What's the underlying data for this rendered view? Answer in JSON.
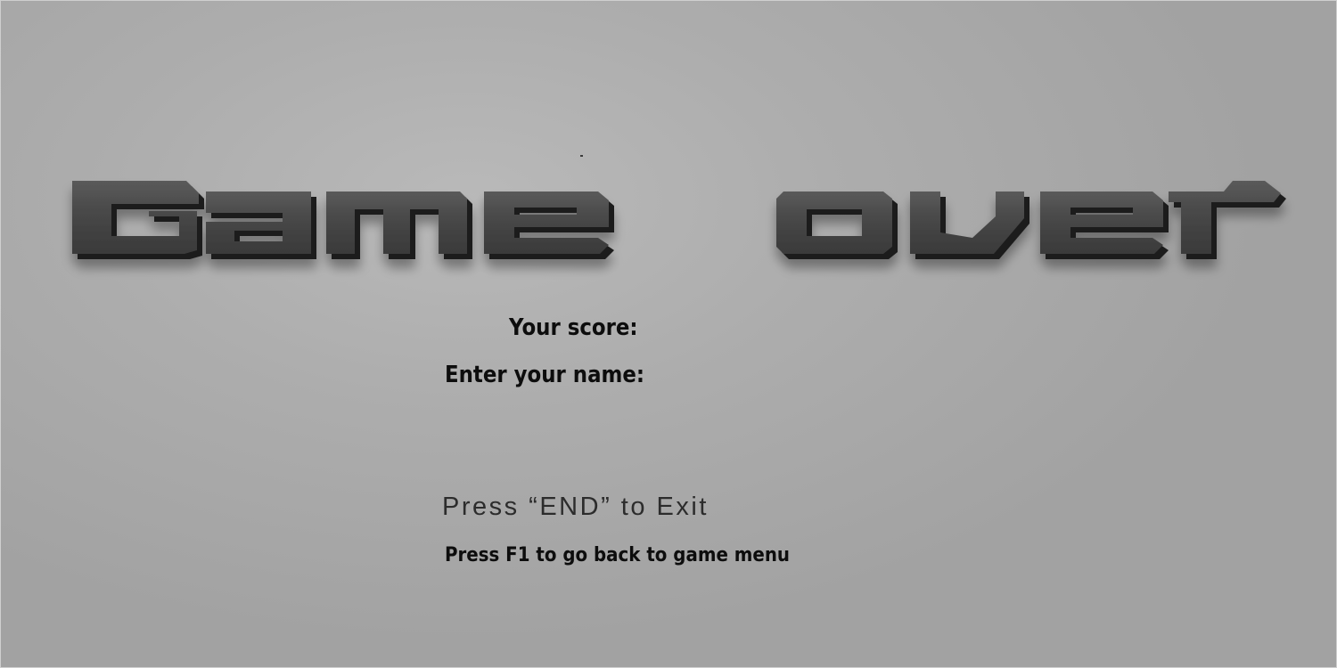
{
  "screen": {
    "title": "Game over",
    "title_words": [
      "Game",
      "over"
    ],
    "background_color": "#adadad",
    "title_color": "#4a4a4a"
  },
  "score": {
    "label": "Your score:"
  },
  "name_entry": {
    "label": "Enter your name:",
    "value": "",
    "placeholder": ""
  },
  "hints": {
    "exit": "Press “END” to Exit",
    "menu": "Press F1 to go back to game menu"
  }
}
